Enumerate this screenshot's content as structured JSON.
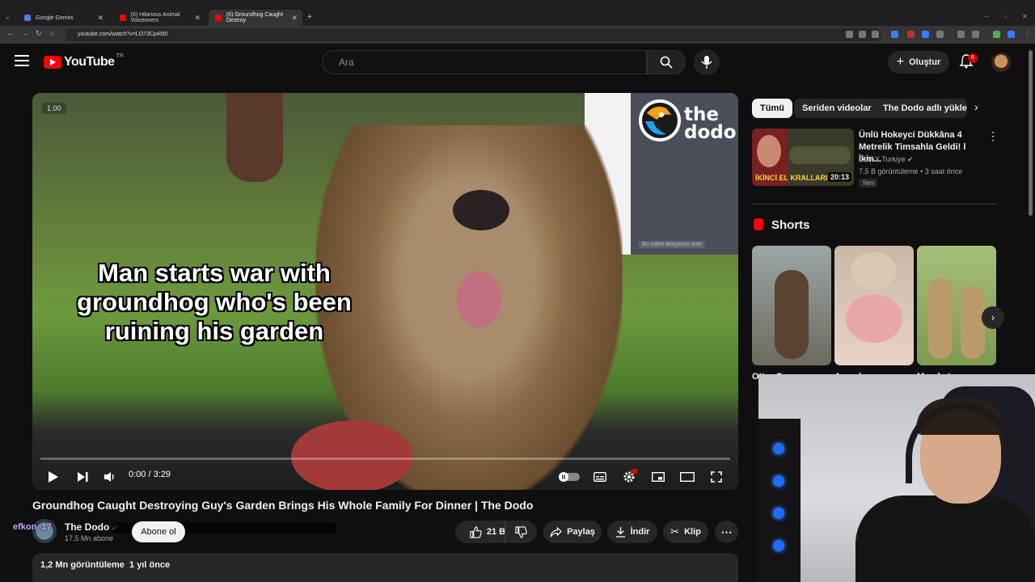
{
  "browser": {
    "tabs": [
      {
        "label": "Google Gemini",
        "active": false
      },
      {
        "label": "(6) Hilarious Animal Voiceovers",
        "active": false
      },
      {
        "label": "(6) Groundhog Caught Destroy",
        "active": true
      }
    ],
    "url": "youtube.com/watch?v=LO73Cp45tII"
  },
  "header": {
    "logo_text": "YouTube",
    "region": "TR",
    "search_placeholder": "Ara",
    "create_label": "Oluştur",
    "notification_count": "6"
  },
  "player": {
    "caption": "Man starts war with groundhog who's been ruining his garden",
    "brand_overlay": "the dodo",
    "speed_badge": "1.00",
    "download_hint": "Bu video dosyasını indir",
    "time": "0:00 / 3:29",
    "progress": 0.0
  },
  "video": {
    "title": "Groundhog Caught Destroying Guy's Garden Brings His Whole Family For Dinner | The Dodo",
    "channel": "The Dodo",
    "subscribers": "17,5 Mn abone",
    "subscribe_label": "Abone ol",
    "likes": "21 B",
    "share_label": "Paylaş",
    "download_label": "İndir",
    "clip_label": "Klip",
    "views": "1,2 Mn görüntüleme",
    "age": "1 yıl önce"
  },
  "stream_overlay": {
    "username": "efkon_17"
  },
  "sidebar": {
    "chips": [
      "Tümü",
      "Seriden videolar",
      "The Dodo adlı yükleyici"
    ],
    "recommended": {
      "title": "Ünlü Hokeyci Dükkâna 4 Metrelik Timsahla Geldi! l İkin...",
      "channel": "DMAX Turkiye",
      "meta": "7,5 B görüntüleme • 3 saat önce",
      "badge": "Yeni",
      "duration": "20:13",
      "thumb_text": "İKİNCİ EL KRALLARI"
    },
    "shorts_title": "Shorts",
    "shorts": [
      {
        "label": "Otter C..."
      },
      {
        "label": "A pock..."
      },
      {
        "label": "Meerkat..."
      }
    ]
  },
  "colors": {
    "brand_red": "#ff0000",
    "background": "#0f0f0f",
    "chip_bg": "#272727"
  }
}
